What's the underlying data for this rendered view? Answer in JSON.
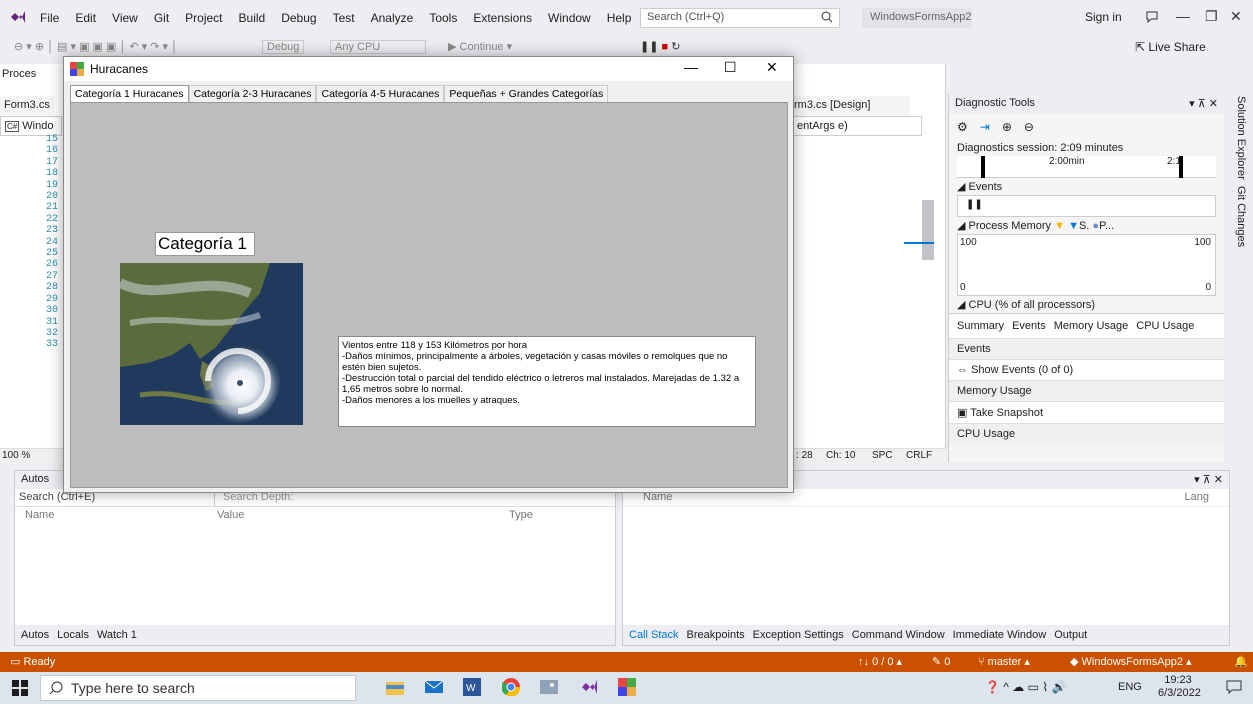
{
  "menubar": {
    "items": [
      "File",
      "Edit",
      "View",
      "Git",
      "Project",
      "Build",
      "Debug",
      "Test",
      "Analyze",
      "Tools",
      "Extensions",
      "Window",
      "Help"
    ],
    "search_placeholder": "Search (Ctrl+Q)",
    "solution_name": "WindowsFormsApp2",
    "sign_in": "Sign in"
  },
  "toolbar": {
    "config": "Debug",
    "platform": "Any CPU",
    "continue_label": "Continue",
    "live_share": "Live Share"
  },
  "editor": {
    "left_tab": "Form3.cs",
    "left_dropdown": "Windo",
    "designer_tab": "rm3.cs [Design]",
    "member_dropdown": "entArgs e)",
    "process_label": "Proces",
    "line_numbers": [
      "15",
      "16",
      "17",
      "18",
      "19",
      "20",
      "21",
      "22",
      "23",
      "24",
      "25",
      "26",
      "27",
      "28",
      "29",
      "30",
      "31",
      "32",
      "33"
    ],
    "zoom": "100 %",
    "status_ln": "28",
    "status_ch": "Ch: 10",
    "status_spc": "SPC",
    "status_crlf": "CRLF"
  },
  "diagnostics": {
    "title": "Diagnostic Tools",
    "session": "Diagnostics session: 2:09 minutes",
    "timeline_label": "2:00min",
    "timeline_label2": "2:1",
    "events_header": "Events",
    "process_memory_header": "Process Memory",
    "pm_legend_s": "S.",
    "pm_legend_p": "P...",
    "pm_max_left": "100",
    "pm_max_right": "100",
    "pm_min_left": "0",
    "pm_min_right": "0",
    "cpu_header": "CPU (% of all processors)",
    "summary_tabs": [
      "Summary",
      "Events",
      "Memory Usage",
      "CPU Usage"
    ],
    "events_section": "Events",
    "show_events": "Show Events (0 of 0)",
    "memory_section": "Memory Usage",
    "take_snapshot": "Take Snapshot",
    "cpu_section": "CPU Usage"
  },
  "side_strip": {
    "solution_explorer": "Solution Explorer",
    "git_changes": "Git Changes"
  },
  "autos": {
    "title": "Autos",
    "search_placeholder": "Search (Ctrl+E)",
    "search_depth": "Search Depth:",
    "col_name": "Name",
    "col_value": "Value",
    "col_type": "Type",
    "tabs": [
      "Autos",
      "Locals",
      "Watch 1"
    ]
  },
  "callstack": {
    "col_name": "Name",
    "col_lang": "Lang",
    "tabs": [
      "Call Stack",
      "Breakpoints",
      "Exception Settings",
      "Command Window",
      "Immediate Window",
      "Output"
    ]
  },
  "statusbar": {
    "ready": "Ready",
    "arrows": "0 / 0",
    "pencil": "0",
    "branch": "master",
    "project": "WindowsFormsApp2"
  },
  "taskbar": {
    "search_placeholder": "Type here to search",
    "lang": "ENG",
    "time": "19:23",
    "date": "6/3/2022"
  },
  "huracanes_window": {
    "title": "Huracanes",
    "tabs": [
      "Categoría 1 Huracanes",
      "Categoría 2-3 Huracanes",
      "Categoría 4-5 Huracanes",
      "Pequeñas + Grandes Categorías"
    ],
    "category_label": "Categoría 1",
    "info_text": "Vientos entre 118 y 153 Kilómetros por hora\n-Daños mínimos, principalmente a árboles, vegetación y casas móviles o remolques que no estén bien sujetos.\n-Destrucción total o parcial del tendido eléctrico o letreros mal instalados. Marejadas de 1.32 a 1,65 metros sobre lo normal.\n-Daños menores a los muelles y atraques."
  },
  "colors": {
    "status_orange": "#ca5100",
    "accent_blue": "#0078d4",
    "tab_page_gray": "#bdbdbd"
  }
}
